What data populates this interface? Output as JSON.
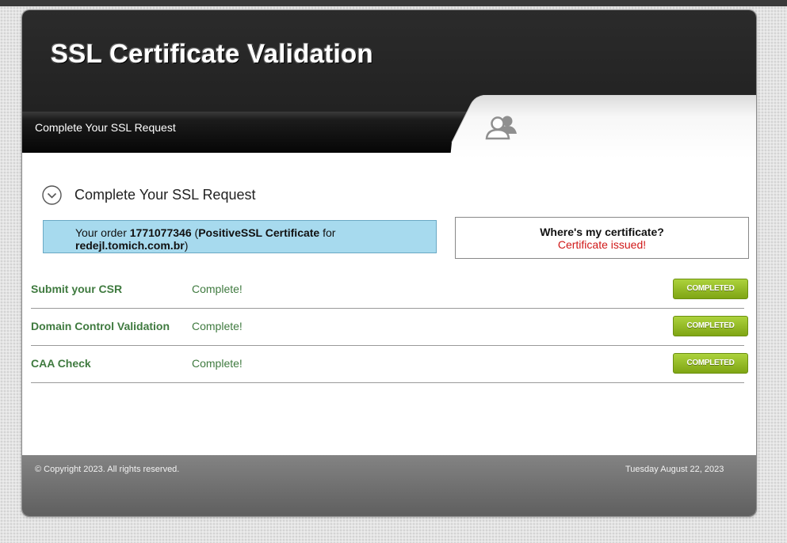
{
  "header": {
    "title": "SSL Certificate Validation"
  },
  "nav": {
    "label": "Complete Your SSL Request"
  },
  "icons": {
    "users": "users-icon",
    "chevron": "chevron-down-circle-icon"
  },
  "section": {
    "title": "Complete Your SSL Request"
  },
  "order": {
    "prefix": "Your order ",
    "number": "1771077346",
    "open_paren": " (",
    "product": "PositiveSSL Certificate",
    "for_text": " for",
    "domain": "redejl.tomich.com.br",
    "close_paren": ")"
  },
  "certificate": {
    "question": "Where's my certificate?",
    "status": "Certificate issued!",
    "status_color": "#d01818"
  },
  "steps": [
    {
      "name": "Submit your CSR",
      "status": "Complete!",
      "badge": "COMPLETED"
    },
    {
      "name": "Domain Control Validation",
      "status": "Complete!",
      "badge": "COMPLETED"
    },
    {
      "name": "CAA Check",
      "status": "Complete!",
      "badge": "COMPLETED"
    }
  ],
  "colors": {
    "step_text": "#3f7a3f",
    "badge": "#8bb41e",
    "order_box": "#a7daee"
  },
  "footer": {
    "copyright": "© Copyright 2023. All rights reserved.",
    "date": "Tuesday August 22, 2023"
  }
}
